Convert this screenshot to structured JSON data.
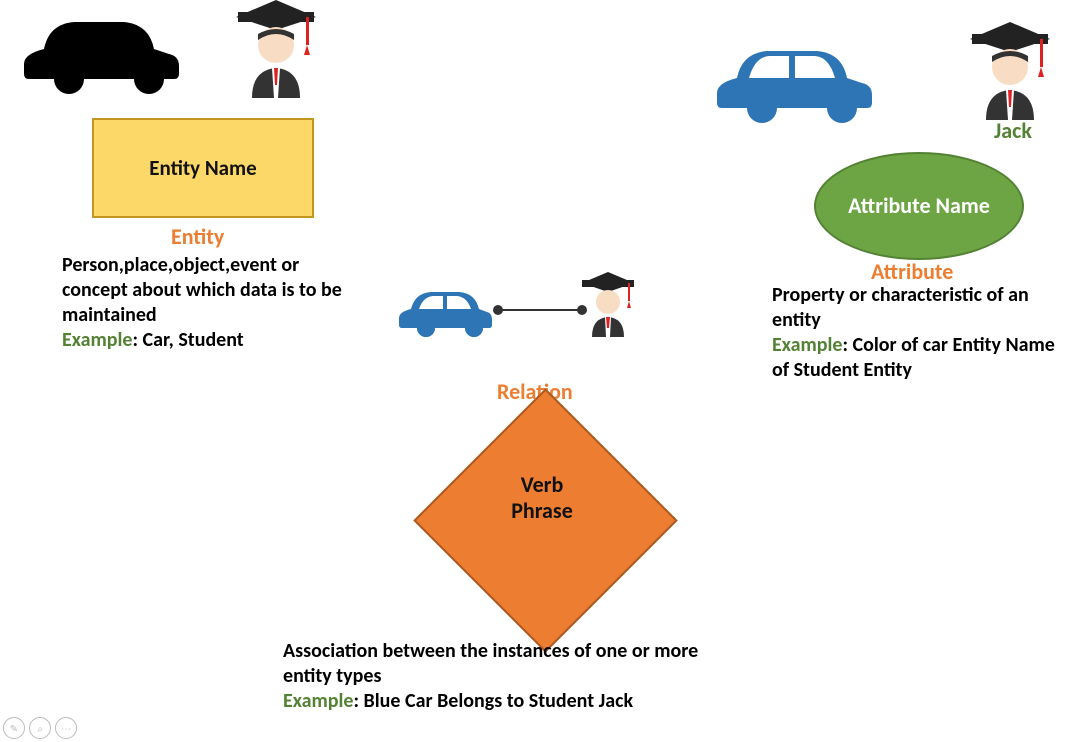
{
  "entity": {
    "shape_label": "Entity Name",
    "heading": "Entity",
    "desc": "Person,place,object,event or concept about which data is to be maintained",
    "example_label": "Example",
    "example_text": ": Car, Student"
  },
  "relation": {
    "heading": "Relation",
    "shape_label_line1": "Verb",
    "shape_label_line2": "Phrase",
    "desc": "Association between the instances of one or more entity types",
    "example_label": "Example",
    "example_text": ": Blue Car Belongs to Student Jack"
  },
  "attribute": {
    "jack_label": "Jack",
    "shape_label": "Attribute Name",
    "heading": "Attribute",
    "desc": "Property or characteristic of an entity",
    "example_label": "Example",
    "example_text": ": Color of car Entity Name of Student Entity"
  }
}
